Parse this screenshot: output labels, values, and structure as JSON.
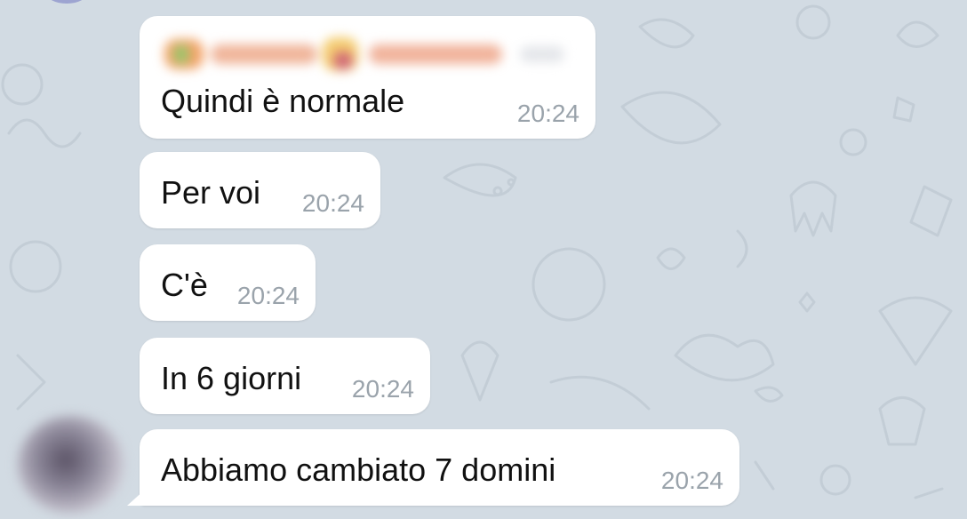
{
  "chat": {
    "messages": [
      {
        "text": "Quindi è normale",
        "time": "20:24",
        "has_reply_preview": true
      },
      {
        "text": "Per voi",
        "time": "20:24"
      },
      {
        "text": "C'è",
        "time": "20:24"
      },
      {
        "text": "In 6 giorni",
        "time": "20:24"
      },
      {
        "text": "Abbiamo cambiato 7 domini",
        "time": "20:24"
      }
    ],
    "sender_avatar": "blurred-avatar",
    "background": "doodle-pattern"
  },
  "colors": {
    "background": "#d2dbe3",
    "bubble": "#ffffff",
    "text": "#111111",
    "timestamp": "#9aa3ab",
    "doodle": "#c3cdd6"
  }
}
